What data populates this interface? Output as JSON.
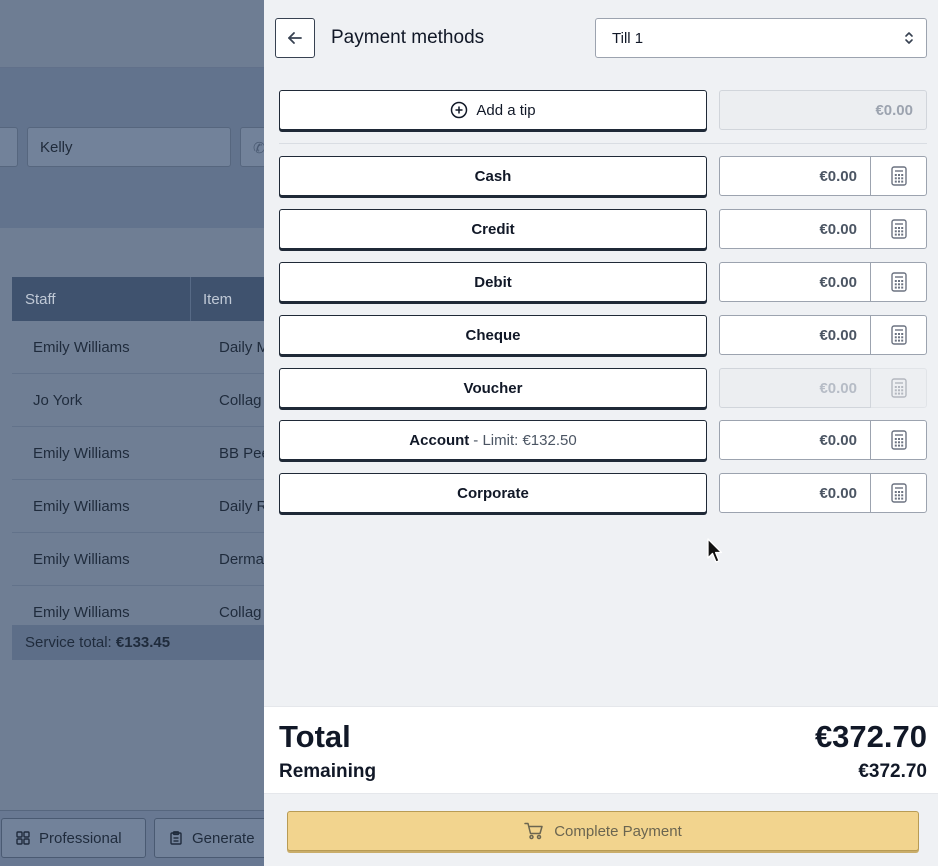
{
  "background": {
    "client_input": "Kelly",
    "table": {
      "headers": [
        "Staff",
        "Item"
      ],
      "rows": [
        [
          "Emily Williams",
          "Daily M"
        ],
        [
          "Jo York",
          "Collag"
        ],
        [
          "Emily Williams",
          "BB Pee"
        ],
        [
          "Emily Williams",
          "Daily R"
        ],
        [
          "Emily Williams",
          "Derma"
        ],
        [
          "Emily Williams",
          "Collag"
        ]
      ]
    },
    "service_total_label": "Service total:",
    "service_total_value": "€133.45",
    "footer_buttons": [
      "Professional",
      "Generate"
    ]
  },
  "drawer": {
    "title": "Payment methods",
    "till": "Till 1",
    "tip": {
      "label": "Add a tip",
      "amount": "€0.00"
    },
    "methods": [
      {
        "label": "Cash",
        "amount": "€0.00",
        "disabled": false
      },
      {
        "label": "Credit",
        "amount": "€0.00",
        "disabled": false
      },
      {
        "label": "Debit",
        "amount": "€0.00",
        "disabled": false
      },
      {
        "label": "Cheque",
        "amount": "€0.00",
        "disabled": false
      },
      {
        "label": "Voucher",
        "amount": "€0.00",
        "disabled": true
      },
      {
        "label": "Account",
        "limit": "- Limit: €132.50",
        "amount": "€0.00",
        "disabled": false
      },
      {
        "label": "Corporate",
        "amount": "€0.00",
        "disabled": false
      }
    ],
    "totals": {
      "total_label": "Total",
      "total_value": "€372.70",
      "remaining_label": "Remaining",
      "remaining_value": "€372.70"
    },
    "complete_label": "Complete Payment"
  },
  "icons": {
    "back": "arrow-left-icon",
    "till_select": "chevron-up-down-icon",
    "tip": "plus-circle-icon",
    "calculator": "calculator-icon",
    "cart": "cart-icon",
    "professional": "grid-icon",
    "generate": "clipboard-icon"
  },
  "colors": {
    "complete_button": "#f2d48e",
    "overlay": "#6b7a90",
    "table_header": "#3f526e"
  }
}
